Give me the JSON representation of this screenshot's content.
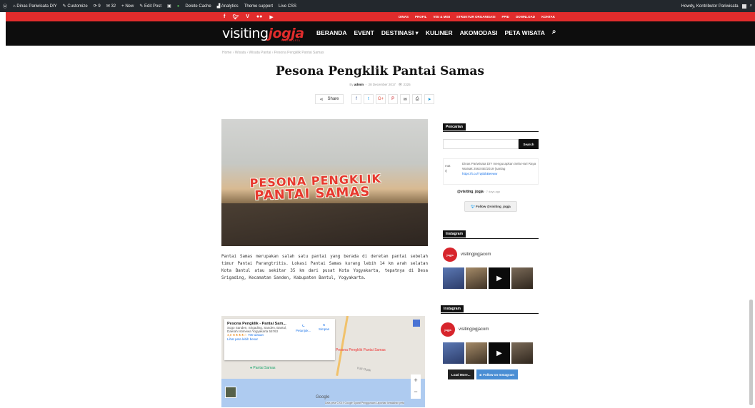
{
  "wp_admin_bar": {
    "site_name": "Dinas Pariwisata DIY",
    "customize": "Customize",
    "updates": "9",
    "comments": "32",
    "new": "New",
    "edit_post": "Edit Post",
    "delete_cache": "Delete Cache",
    "analytics": "Analytics",
    "theme_support": "Theme support",
    "live_css": "Live CSS",
    "howdy": "Howdy, Kontributor Pariwisata"
  },
  "top_bar": {
    "menu": [
      "DINAS",
      "PROFIL",
      "VISI & MISI",
      "STRUKTUR ORGANISASI",
      "PPID",
      "DOWNLOAD",
      "KONTAK"
    ],
    "social_icons": [
      "facebook-icon",
      "twitter-icon",
      "vimeo-icon",
      "flickr-icon",
      "youtube-icon"
    ]
  },
  "header": {
    "logo_main": "visiting",
    "logo_accent": "jogja",
    "logo_sub": "YOGYAKARTA",
    "nav": [
      "BERANDA",
      "EVENT",
      "DESTINASI ▾",
      "KULINER",
      "AKOMODASI",
      "PETA WISATA"
    ]
  },
  "breadcrumb": "Home  ›  Wisata  ›  Wisata Pantai  ›  Pesona Pengklik Pantai Samas",
  "article": {
    "title": "Pesona Pengklik Pantai Samas",
    "by": "By",
    "author": "admin",
    "date": "28 December 2017",
    "views": "2325",
    "share_label": "Share",
    "share_icons": [
      "facebook-icon",
      "twitter-icon",
      "googleplus-icon",
      "pinterest-icon",
      "email-icon",
      "print-icon",
      "telegram-icon"
    ],
    "hero_line1": "PESONA PENGKLIK",
    "hero_line2": "PANTAI SAMAS",
    "body": "Pantai Samas merupakan salah satu pantai yang berada di deretan pantai sebelah timur Pantai Parangtritis. Lokasi Pantai Samas kurang lebih 14 km arah selatan Kota Bantul atau sekitar 35 km dari pusat Kota Yogyakarta, tepatnya di Desa Srigading, Kecamatan Sanden, Kabupaten Bantul, Yogyakarta."
  },
  "map": {
    "place_title": "Pesona Pengklik - Pantai Sam...",
    "address": "Sogo Sanden, Srigading, Sanden, Bantul, Daerah Istimewa Yogyakarta 55763",
    "rating": "4,0 ★★★★☆",
    "reviews": "700 ulasan",
    "bigger_map": "Lihat peta lebih besar",
    "directions": "Petunjuk...",
    "save": "Simpan",
    "pin_label": "Pesona Pengklik Pantai Samas",
    "pin2_label": "Pantai Samas",
    "road_label": "Kali Opak",
    "google": "Google",
    "credit": "Data peta ©2019 Google   Syarat Penggunaan   Laporkan kesalahan peta"
  },
  "sidebar": {
    "search_heading": "Pencarian",
    "search_button": "Search",
    "tweet_left": "mat\nr)",
    "tweet_text": "Dinas Pariwisata DIY mengucapkan Sela Hari Raya Waisak 2563 BE/2019 (sanlag",
    "tweet_link": "https://t.co/Tq6bbBeeww",
    "tweeter_handle": "@visiting_jogja",
    "tweeter_time": "· 7 days ago",
    "follow_button": "Follow @visiting_jogja",
    "ig_heading": "Instagram",
    "ig_user": "visitingjogjacom",
    "ig_avatar_text": "jogja",
    "load_more": "Load More...",
    "follow_instagram": "Follow on Instagram"
  }
}
